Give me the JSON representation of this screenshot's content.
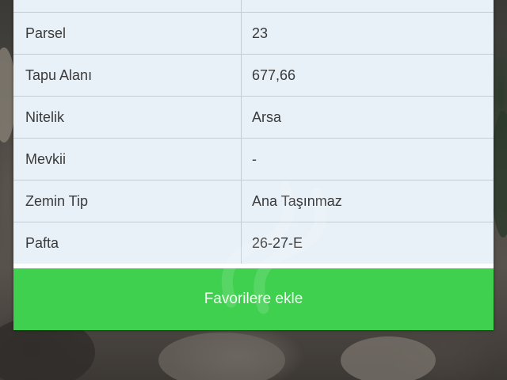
{
  "table": {
    "rows": [
      {
        "label": "",
        "value": ""
      },
      {
        "label": "Parsel",
        "value": "23"
      },
      {
        "label": "Tapu Alanı",
        "value": "677,66"
      },
      {
        "label": "Nitelik",
        "value": "Arsa"
      },
      {
        "label": "Mevkii",
        "value": "-"
      },
      {
        "label": "Zemin Tip",
        "value": "Ana Taşınmaz"
      },
      {
        "label": "Pafta",
        "value": "26-27-E"
      }
    ]
  },
  "actions": {
    "favorite_label": "Favorilere ekle"
  },
  "colors": {
    "button": "#3fd050",
    "row_background": "#e9f1f8",
    "border": "#c3cdd6"
  }
}
